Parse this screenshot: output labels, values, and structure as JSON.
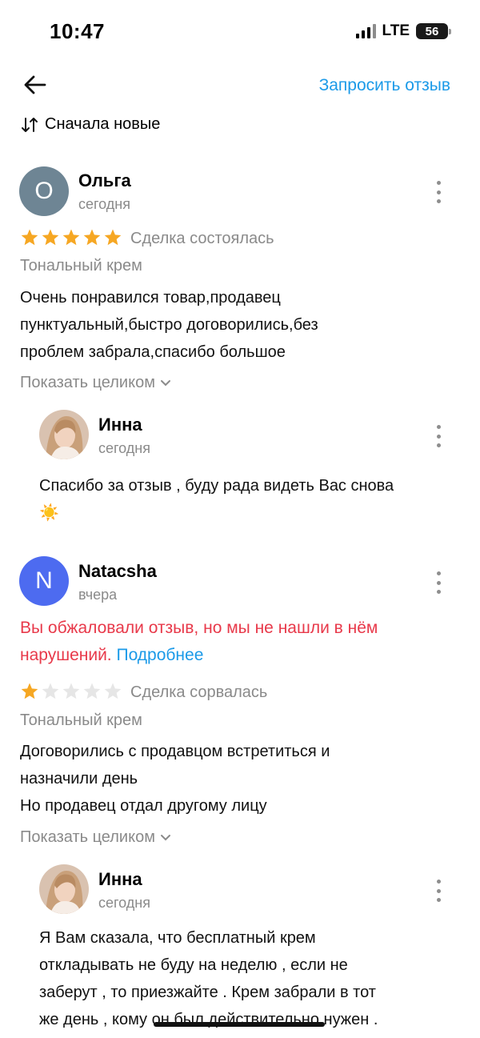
{
  "status_bar": {
    "time": "10:47",
    "network": "LTE",
    "battery": "56"
  },
  "header": {
    "request_review_label": "Запросить отзыв",
    "sort_label": "Сначала новые"
  },
  "reviews": [
    {
      "author": "Ольга",
      "avatar_letter": "О",
      "avatar_color": "#6e8594",
      "date": "сегодня",
      "rating": 5,
      "deal_status": "Сделка состоялась",
      "product": "Тональный крем",
      "text_lines": [
        "Очень понравился товар,продавец",
        "пунктуальный,быстро договорились,без",
        "проблем забрала,спасибо большое"
      ],
      "show_all_label": "Показать целиком",
      "reply": {
        "author": "Инна",
        "date": "сегодня",
        "text_lines": [
          "Спасибо за отзыв , буду рада видеть Вас снова",
          "☀️"
        ]
      }
    },
    {
      "author": "Natacsha",
      "avatar_letter": "N",
      "avatar_color": "#4d6bf0",
      "date": "вчера",
      "warning_text": "Вы обжаловали отзыв, но мы не нашли в нём нарушений.",
      "warning_link": "Подробнее",
      "rating": 1,
      "deal_status": "Сделка сорвалась",
      "product": "Тональный крем",
      "text_lines": [
        "Договорились с продавцом встретиться и",
        "назначили день",
        "Но продавец отдал другому лицу"
      ],
      "show_all_label": "Показать целиком",
      "reply": {
        "author": "Инна",
        "date": "сегодня",
        "text_lines": [
          "Я Вам сказала, что бесплатный крем",
          "откладывать не буду на неделю , если не",
          "заберут , то приезжайте . Крем забрали  в тот",
          "же день , кому он был действительно нужен ."
        ]
      }
    }
  ],
  "colors": {
    "accent": "#1b9ae8",
    "warning": "#e8394a",
    "star_filled": "#f6a723",
    "star_empty": "#e6e6e6"
  }
}
